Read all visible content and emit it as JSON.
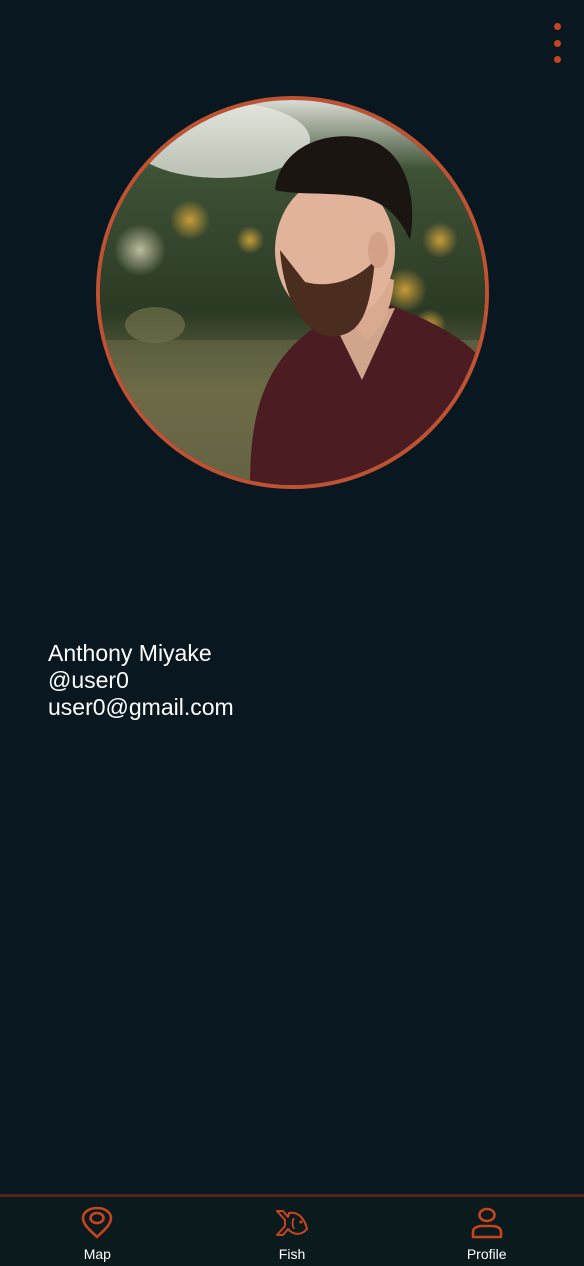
{
  "colors": {
    "background": "#091820",
    "accent": "#c7451e",
    "avatar_ring": "#bf5233",
    "tab_bar_bg": "#0b1a1d",
    "text": "#ffffff"
  },
  "header": {
    "menu_icon": "vertical-ellipsis-icon"
  },
  "profile": {
    "avatar": "profile-photo-man-with-beard",
    "name": "Anthony Miyake",
    "username": "@user0",
    "email": "user0@gmail.com"
  },
  "tabs": [
    {
      "label": "Map",
      "icon": "map-pin-icon"
    },
    {
      "label": "Fish",
      "icon": "fish-icon"
    },
    {
      "label": "Profile",
      "icon": "user-icon"
    }
  ]
}
